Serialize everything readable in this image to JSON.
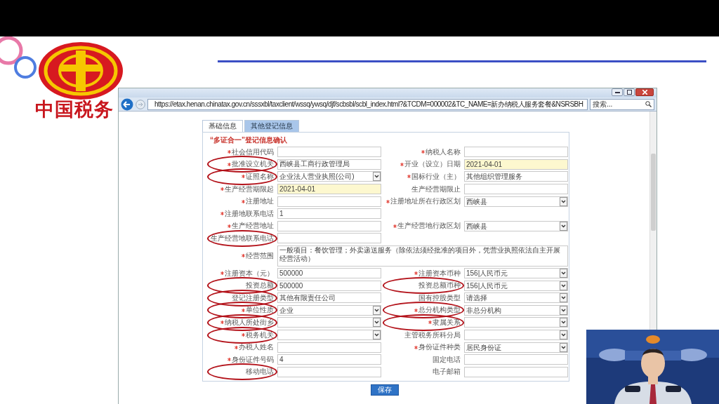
{
  "slide": {
    "logo_text": "中国税务"
  },
  "browser": {
    "url": "https://etax.henan.chinatax.gov.cn/sssxbl/taxclient/wssq/ywsq/djf/scbsbl/scbl_index.html?&TCDM=000002&TC_NAME=新办纳税人服务套餐&NSRSBH",
    "search_placeholder": "搜索..."
  },
  "tabs": [
    {
      "label": "基础信息",
      "selected": true
    },
    {
      "label": "其他登记信息",
      "selected": false
    }
  ],
  "form": {
    "title": "“多证合一”登记信息确认",
    "rows": [
      {
        "kind": "pair",
        "left": {
          "label": "社会信用代码",
          "required": true,
          "kind": "input",
          "highlighted": false,
          "circled": false
        },
        "right": {
          "label": "纳税人名称",
          "required": true,
          "kind": "input",
          "highlighted": false,
          "circled": false
        }
      },
      {
        "kind": "pair",
        "left": {
          "label": "批准设立机关",
          "required": true,
          "kind": "input",
          "value": "西峡县工商行政管理局",
          "highlighted": false,
          "circled": true
        },
        "right": {
          "label": "开业（设立）日期",
          "required": true,
          "kind": "input",
          "value": "2021-04-01",
          "highlighted": true,
          "circled": false
        }
      },
      {
        "kind": "pair",
        "left": {
          "label": "证照名称",
          "required": true,
          "kind": "select",
          "value": "企业法人营业执照(公司)",
          "highlighted": false,
          "circled": true
        },
        "right": {
          "label": "国标行业（主）",
          "required": true,
          "kind": "input",
          "value": "其他组织管理服务",
          "highlighted": false,
          "circled": false
        }
      },
      {
        "kind": "pair",
        "left": {
          "label": "生产经营期限起",
          "required": true,
          "kind": "input",
          "value": "2021-04-01",
          "highlighted": true,
          "circled": false
        },
        "right": {
          "label": "生产经营期限止",
          "required": false,
          "kind": "input",
          "highlighted": false,
          "circled": false
        }
      },
      {
        "kind": "pair",
        "left": {
          "label": "注册地址",
          "required": true,
          "kind": "input",
          "highlighted": false,
          "circled": false
        },
        "right": {
          "label": "注册地址所在行政区划",
          "required": true,
          "kind": "select",
          "value": "西峡县",
          "highlighted": false,
          "circled": false
        }
      },
      {
        "kind": "pair",
        "left": {
          "label": "注册地联系电话",
          "required": true,
          "kind": "input",
          "value": "1",
          "highlighted": false,
          "circled": false
        }
      },
      {
        "kind": "pair",
        "left": {
          "label": "生产经营地址",
          "required": true,
          "kind": "input",
          "highlighted": false,
          "circled": false
        },
        "right": {
          "label": "生产经营地行政区划",
          "required": true,
          "kind": "select",
          "value": "西峡县",
          "highlighted": false,
          "circled": false
        }
      },
      {
        "kind": "pair",
        "left": {
          "label": "生产经营地联系电话",
          "required": false,
          "kind": "input",
          "highlighted": false,
          "circled": true
        }
      },
      {
        "kind": "wide",
        "left": {
          "label": "经营范围",
          "required": true,
          "kind": "textarea",
          "value": "一般项目：餐饮管理；外卖递送服务（除依法须经批准的项目外，凭营业执照依法自主开展经营活动）",
          "highlighted": false,
          "circled": false
        }
      },
      {
        "kind": "pair",
        "left": {
          "label": "注册资本（元）",
          "required": true,
          "kind": "input",
          "value": "500000",
          "highlighted": false,
          "circled": false
        },
        "right": {
          "label": "注册资本币种",
          "required": true,
          "kind": "select",
          "value": "156|人民币元",
          "highlighted": false,
          "circled": false
        }
      },
      {
        "kind": "pair",
        "left": {
          "label": "投资总额",
          "required": false,
          "kind": "input",
          "value": "500000",
          "highlighted": false,
          "circled": true
        },
        "right": {
          "label": "投资总额币种",
          "required": false,
          "kind": "select",
          "value": "156|人民币元",
          "highlighted": false,
          "circled": true
        }
      },
      {
        "kind": "pair",
        "left": {
          "label": "登记注册类型",
          "required": false,
          "kind": "input",
          "value": "其他有限责任公司",
          "highlighted": false,
          "circled": true
        },
        "right": {
          "label": "国有控股类型",
          "required": false,
          "kind": "select",
          "value": "请选择",
          "highlighted": false,
          "circled": false
        }
      },
      {
        "kind": "pair",
        "left": {
          "label": "单位性质",
          "required": true,
          "kind": "select",
          "value": "企业",
          "highlighted": false,
          "circled": true
        },
        "right": {
          "label": "总分机构类型",
          "required": true,
          "kind": "select",
          "value": "非总分机构",
          "highlighted": false,
          "circled": true
        }
      },
      {
        "kind": "pair",
        "left": {
          "label": "纳税人所处街乡",
          "required": true,
          "kind": "select",
          "highlighted": false,
          "circled": true
        },
        "right": {
          "label": "隶属关系",
          "required": true,
          "kind": "select",
          "highlighted": false,
          "circled": true
        }
      },
      {
        "kind": "pair",
        "left": {
          "label": "税务机关",
          "required": true,
          "kind": "select",
          "highlighted": false,
          "circled": true
        },
        "right": {
          "label": "主管税务所科分局",
          "required": false,
          "kind": "select",
          "highlighted": false,
          "circled": false
        }
      },
      {
        "kind": "pair",
        "left": {
          "label": "办税人姓名",
          "required": true,
          "kind": "input",
          "highlighted": false,
          "circled": false
        },
        "right": {
          "label": "身份证件种类",
          "required": true,
          "kind": "select",
          "value": "居民身份证",
          "highlighted": false,
          "circled": false
        }
      },
      {
        "kind": "pair",
        "left": {
          "label": "身份证件号码",
          "required": true,
          "kind": "input",
          "value": "4",
          "highlighted": false,
          "circled": false
        },
        "right": {
          "label": "固定电话",
          "required": false,
          "kind": "input",
          "highlighted": false,
          "circled": false
        }
      },
      {
        "kind": "pair",
        "left": {
          "label": "移动电话",
          "required": false,
          "kind": "input",
          "highlighted": false,
          "circled": true
        },
        "right": {
          "label": "电子邮箱",
          "required": false,
          "kind": "input",
          "highlighted": false,
          "circled": false
        }
      }
    ]
  },
  "save_button": "保存"
}
